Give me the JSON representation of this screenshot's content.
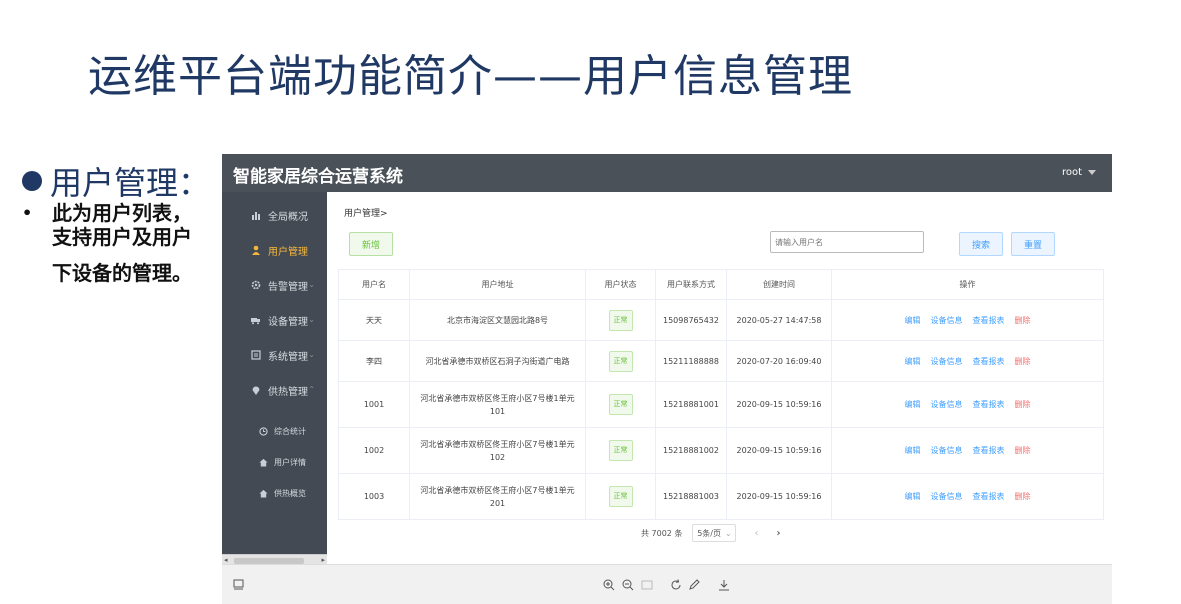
{
  "slide": {
    "title": "运维平台端功能简介——用户信息管理",
    "bullet_heading": "用户管理：",
    "sub_bullet_lines": [
      "此为用户列表，",
      "支持用户及用户",
      "下设备的管理。"
    ]
  },
  "app": {
    "title": "智能家居综合运营系统",
    "user": "root",
    "sidebar": {
      "items": [
        {
          "label": "全局概况",
          "icon": "bar-chart-icon"
        },
        {
          "label": "用户管理",
          "icon": "user-icon"
        },
        {
          "label": "告警管理",
          "icon": "gear-icon"
        },
        {
          "label": "设备管理",
          "icon": "truck-icon"
        },
        {
          "label": "系统管理",
          "icon": "document-icon"
        },
        {
          "label": "供热管理",
          "icon": "location-icon"
        }
      ],
      "sub_items": [
        {
          "label": "综合统计",
          "icon": "clock-icon"
        },
        {
          "label": "用户详情",
          "icon": "home-icon"
        },
        {
          "label": "供热概览",
          "icon": "home-icon"
        }
      ]
    },
    "breadcrumb": "用户管理>",
    "add_button": "新增",
    "search_placeholder": "请输入用户名",
    "search_button": "搜索",
    "reset_button": "重置",
    "table": {
      "headers": [
        "用户名",
        "用户地址",
        "用户状态",
        "用户联系方式",
        "创建时间",
        "操作"
      ],
      "rows": [
        {
          "name": "天天",
          "address": "北京市海淀区文慧园北路8号",
          "status": "正常",
          "phone": "15098765432",
          "created": "2020-05-27 14:47:58"
        },
        {
          "name": "李四",
          "address": "河北省承德市双桥区石洞子沟街道广电路",
          "status": "正常",
          "phone": "15211188888",
          "created": "2020-07-20 16:09:40"
        },
        {
          "name": "1001",
          "address": "河北省承德市双桥区佟王府小区7号楼1单元101",
          "status": "正常",
          "phone": "15218881001",
          "created": "2020-09-15 10:59:16"
        },
        {
          "name": "1002",
          "address": "河北省承德市双桥区佟王府小区7号楼1单元102",
          "status": "正常",
          "phone": "15218881002",
          "created": "2020-09-15 10:59:16"
        },
        {
          "name": "1003",
          "address": "河北省承德市双桥区佟王府小区7号楼1单元201",
          "status": "正常",
          "phone": "15218881003",
          "created": "2020-09-15 10:59:16"
        }
      ],
      "actions": {
        "edit": "编辑",
        "device_info": "设备信息",
        "report": "查看报表",
        "delete": "删除"
      }
    },
    "pagination": {
      "total": "共 7002 条",
      "page_size": "5条/页",
      "prev": "‹",
      "next": "›"
    }
  }
}
